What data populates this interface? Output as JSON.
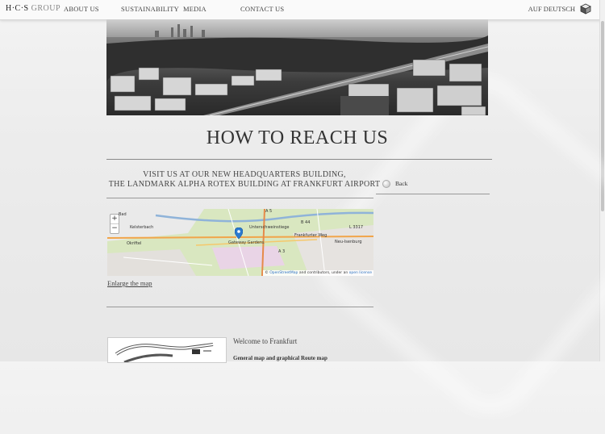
{
  "header": {
    "logo_mark": "H·C·S",
    "logo_group": "GROUP",
    "nav": [
      "ABOUT US",
      "SUSTAINABILITY",
      "MEDIA",
      "CONTACT US"
    ],
    "language": "AUF DEUTSCH"
  },
  "page": {
    "title": "HOW TO REACH US",
    "visit_line1": "VISIT US AT OUR NEW HEADQUARTERS BUILDING,",
    "visit_line2": "THE LANDMARK ALPHA ROTEX BUILDING AT FRANKFURT AIRPORT",
    "back_label": "Back",
    "enlarge_label": "Enlarge the map",
    "welcome": "Welcome to Frankfurt",
    "general": "General map and graphical Route map"
  },
  "map": {
    "zoom_in": "+",
    "zoom_out": "−",
    "labels": {
      "marker": "Gateway Gardens",
      "kelsterbach": "Kelsterbach",
      "okriftel": "Okriftel",
      "neu_isenburg": "Neu-Isenburg",
      "a5": "A 5",
      "a3": "A 3",
      "b44": "B 44",
      "l3317": "L 3317",
      "frankfurter_weg": "Frankfurter Weg",
      "bad": "Bad",
      "unterschweinstiege": "Unterschweinstiege"
    },
    "attribution_prefix": "©",
    "attribution_osm": "OpenStreetMap",
    "attribution_mid": "and contributors, under an",
    "attribution_license": "open license"
  }
}
